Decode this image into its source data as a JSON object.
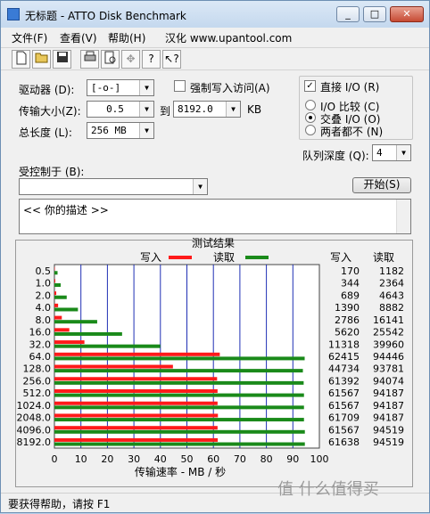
{
  "window": {
    "title": "无标题 - ATTO Disk Benchmark",
    "minimize": "_",
    "maximize": "□",
    "close": "✕"
  },
  "menu": {
    "file": "文件(F)",
    "view": "查看(V)",
    "help": "帮助(H)",
    "credit": "汉化 www.upantool.com"
  },
  "toolbar": {
    "icons": [
      "new-icon",
      "open-icon",
      "save-icon",
      "print-icon",
      "print-preview-icon",
      "move-icon",
      "help-icon",
      "context-help-icon"
    ]
  },
  "settings": {
    "drive_label": "驱动器 (D):",
    "drive_value": "[-o-]",
    "force_write_label": "强制写入访问(A)",
    "force_write_checked": false,
    "transfer_label": "传输大小(Z):",
    "transfer_from": "0.5",
    "to_label": "到",
    "transfer_to": "8192.0",
    "kb_label": "KB",
    "length_label": "总长度 (L):",
    "length_value": "256 MB",
    "direct_io_label": "直接 I/O (R)",
    "direct_io_checked": true,
    "io_compare_label": "I/O 比较 (C)",
    "overlap_io_label": "交叠 I/O (O)",
    "neither_label": "两者都不 (N)",
    "selected_io_mode": "overlap",
    "queue_label": "队列深度 (Q):",
    "queue_value": "4",
    "controlled_by_label": "受控制于 (B):",
    "controlled_by_value": "",
    "start_button": "开始(S)",
    "description": "<<  你的描述  >>"
  },
  "results": {
    "title": "测试结果",
    "write_legend": "写入",
    "read_legend": "读取",
    "write_col": "写入",
    "read_col": "读取"
  },
  "chart_data": {
    "type": "bar",
    "orientation": "horizontal",
    "title": "测试结果",
    "xlabel": "传输速率 - MB / 秒",
    "xlim": [
      0,
      100
    ],
    "xticks": [
      "0",
      "10",
      "20",
      "30",
      "40",
      "50",
      "60",
      "70",
      "80",
      "90",
      "100"
    ],
    "categories": [
      "0.5",
      "1.0",
      "2.0",
      "4.0",
      "8.0",
      "16.0",
      "32.0",
      "64.0",
      "128.0",
      "256.0",
      "512.0",
      "1024.0",
      "2048.0",
      "4096.0",
      "8192.0"
    ],
    "series": [
      {
        "name": "写入",
        "color": "#ff1a1a",
        "values": [
          0.17,
          0.34,
          0.69,
          1.39,
          2.79,
          5.62,
          11.32,
          62.42,
          44.73,
          61.39,
          61.57,
          61.57,
          61.71,
          61.57,
          61.64
        ],
        "labels": [
          "170",
          "344",
          "689",
          "1390",
          "2786",
          "5620",
          "11318",
          "62415",
          "44734",
          "61392",
          "61567",
          "61567",
          "61709",
          "61567",
          "61638"
        ]
      },
      {
        "name": "读取",
        "color": "#1a8a1a",
        "values": [
          1.18,
          2.36,
          4.64,
          8.88,
          16.14,
          25.54,
          39.96,
          94.45,
          93.78,
          94.07,
          94.19,
          94.19,
          94.19,
          94.52,
          94.52
        ],
        "labels": [
          "1182",
          "2364",
          "4643",
          "8882",
          "16141",
          "25542",
          "39960",
          "94446",
          "93781",
          "94074",
          "94187",
          "94187",
          "94187",
          "94519",
          "94519"
        ]
      }
    ],
    "grid_color": "#1f2fb5",
    "plot_bg": "#ffffff"
  },
  "status": {
    "text": "要获得帮助，请按 F1"
  },
  "watermark": {
    "text": "值 什么值得买"
  }
}
